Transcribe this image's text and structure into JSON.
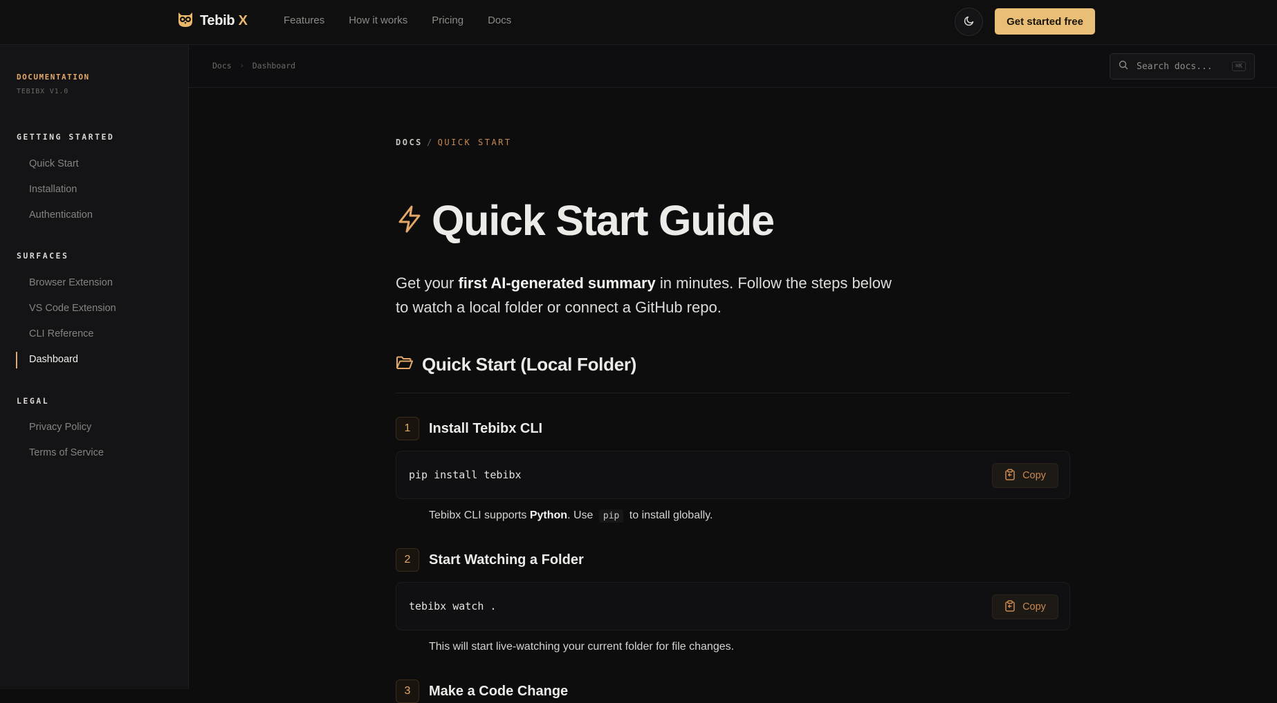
{
  "nav": {
    "brand_name": "Tebib",
    "brand_x": "X",
    "links": [
      "Features",
      "How it works",
      "Pricing",
      "Docs"
    ],
    "cta": "Get started free",
    "icons": {
      "logo": "owl-logo",
      "theme": "moon-icon"
    }
  },
  "sidebar": {
    "title": "DOCUMENTATION",
    "version": "TEBIBX V1.0",
    "sections": [
      {
        "label": "GETTING STARTED",
        "items": [
          "Quick Start",
          "Installation",
          "Authentication"
        ]
      },
      {
        "label": "SURFACES",
        "items": [
          "Browser Extension",
          "VS Code Extension",
          "CLI Reference",
          "Dashboard"
        ]
      },
      {
        "label": "LEGAL",
        "items": [
          "Privacy Policy",
          "Terms of Service"
        ]
      }
    ],
    "active_item": "Dashboard"
  },
  "subheader": {
    "breadcrumb": [
      "Docs",
      "Dashboard"
    ],
    "search_placeholder": "Search docs...",
    "search_shortcut": "⌘K"
  },
  "content": {
    "crumb_root": "DOCS",
    "crumb_sep": "/",
    "crumb_current": "QUICK START",
    "title": "Quick Start Guide",
    "lead_pre": "Get your ",
    "lead_bold": "first AI-generated summary",
    "lead_post": " in minutes. Follow the steps below to watch a local folder or connect a GitHub repo.",
    "section_title": "Quick Start (Local Folder)",
    "copy_label": "Copy",
    "steps": [
      {
        "num": "1",
        "title": "Install Tebibx CLI",
        "code": "pip install tebibx",
        "note_pre": "Tebibx CLI supports ",
        "note_bold": "Python",
        "note_mid": ". Use ",
        "note_code": "pip",
        "note_post": " to install globally."
      },
      {
        "num": "2",
        "title": "Start Watching a Folder",
        "code": "tebibx watch .",
        "note": "This will start live-watching your current folder for file changes."
      },
      {
        "num": "3",
        "title": "Make a Code Change"
      }
    ]
  },
  "colors": {
    "accent": "#e9bf78",
    "accent_text": "#e3a867",
    "background": "#0d0d0e",
    "sidebar": "#141417"
  }
}
